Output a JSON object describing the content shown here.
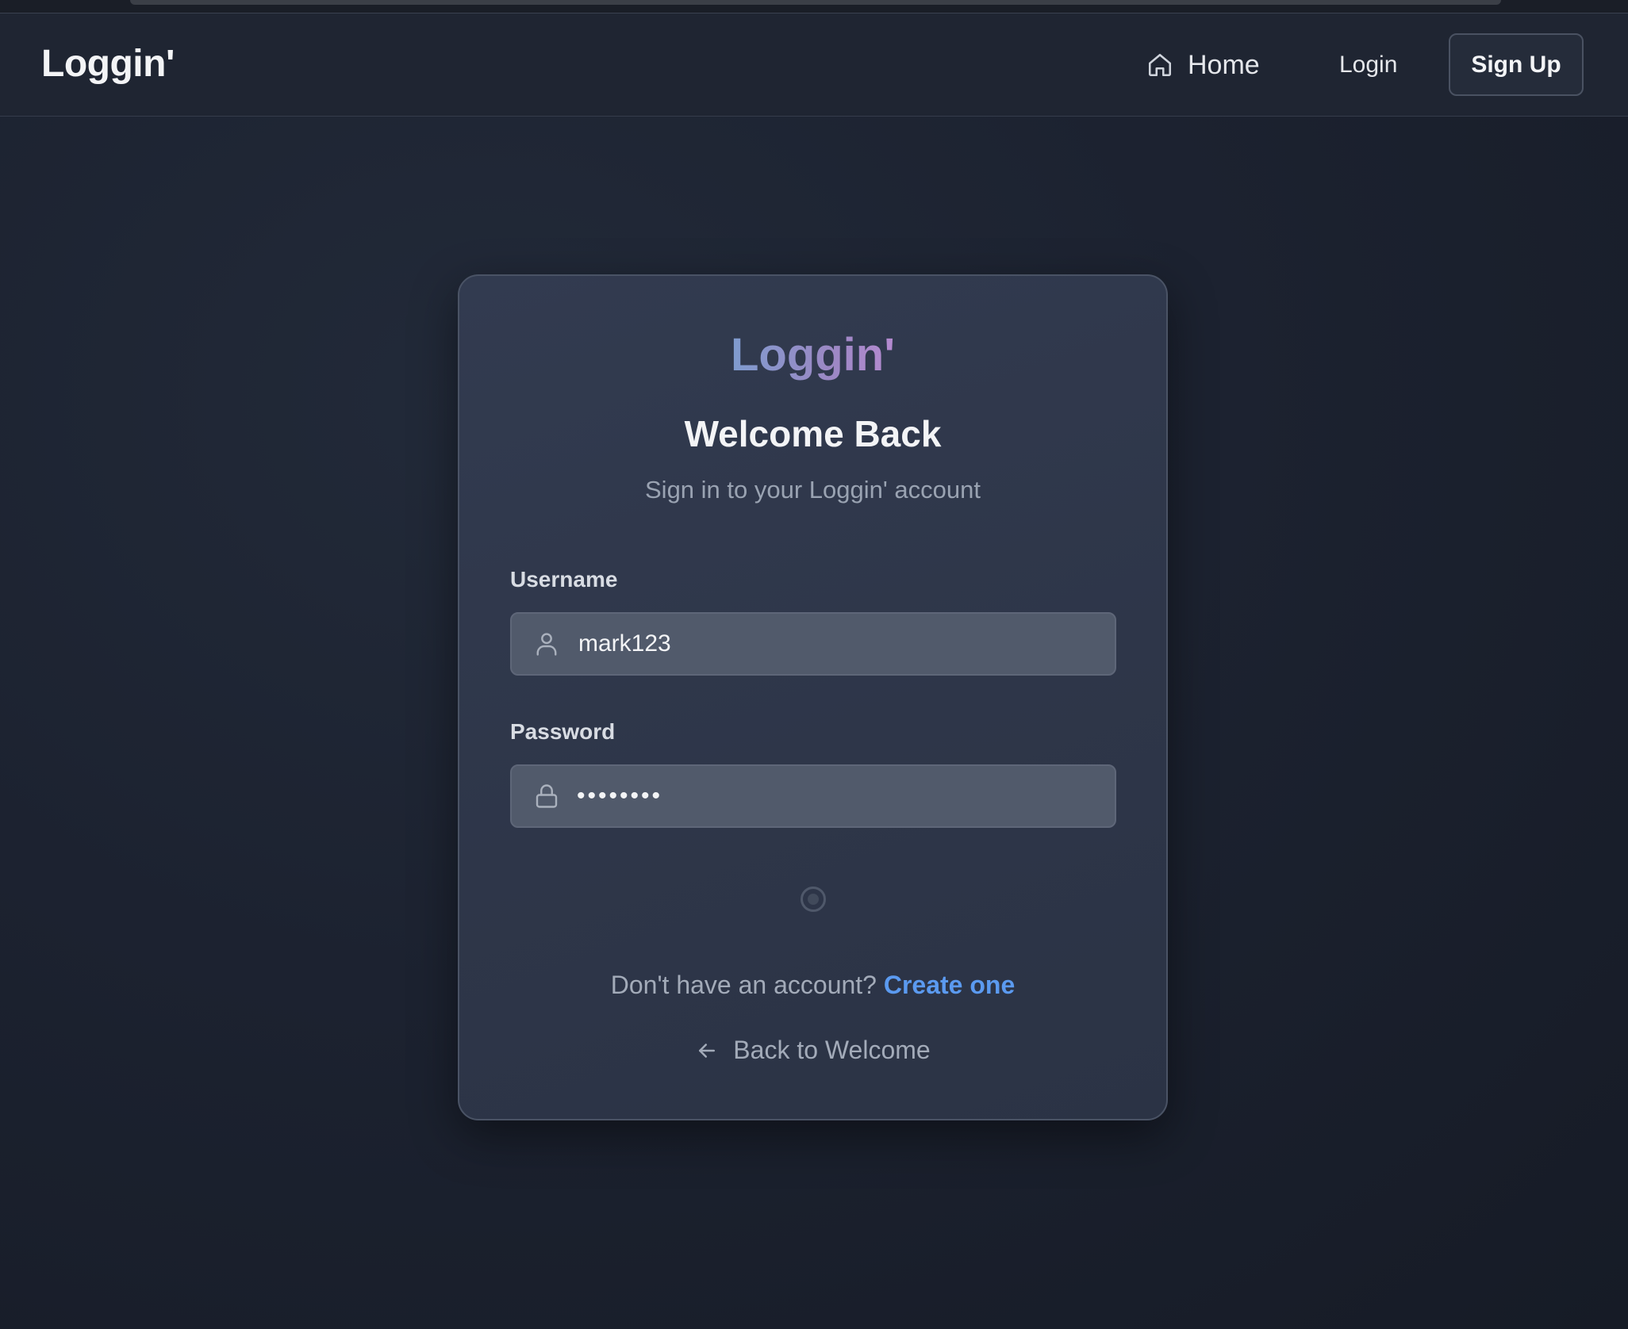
{
  "navbar": {
    "brand": "Loggin'",
    "home_label": "Home",
    "login_label": "Login",
    "signup_label": "Sign Up"
  },
  "card": {
    "logo": "Loggin'",
    "title": "Welcome Back",
    "subtitle": "Sign in to your Loggin' account",
    "username": {
      "label": "Username",
      "value": "mark123",
      "icon": "user-icon"
    },
    "password": {
      "label": "Password",
      "masked_value": "••••••••",
      "icon": "lock-icon"
    },
    "no_account_text": "Don't have an account?",
    "create_link": "Create one",
    "back_label": "Back to Welcome",
    "back_icon": "arrow-left-icon"
  },
  "colors": {
    "link": "#5b9af0",
    "logo_gradient_start": "#7f9ccf",
    "logo_gradient_end": "#b58ad0",
    "background": "#1c2230",
    "card": "#303a4d"
  }
}
